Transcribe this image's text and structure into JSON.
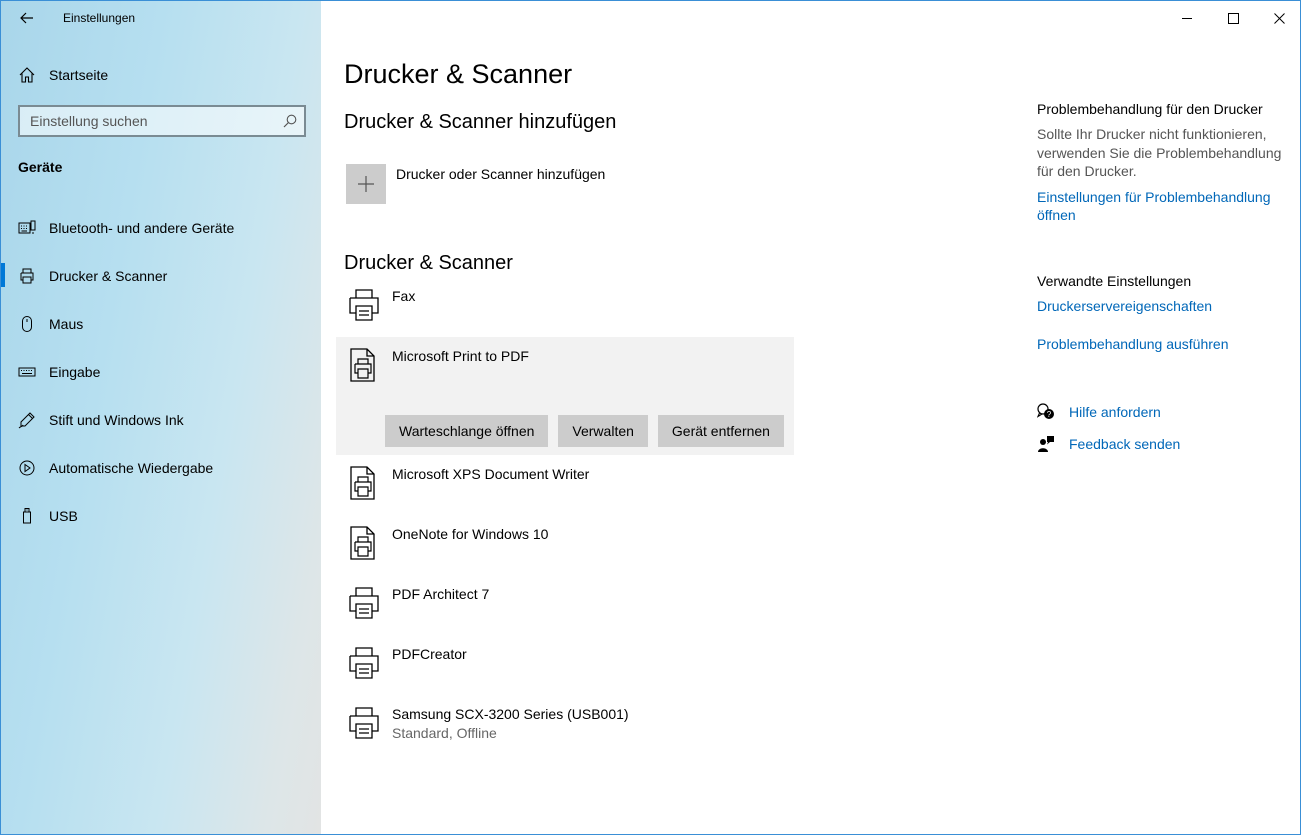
{
  "window": {
    "app_title": "Einstellungen"
  },
  "sidebar": {
    "home_label": "Startseite",
    "search_placeholder": "Einstellung suchen",
    "section_title": "Geräte",
    "items": [
      {
        "label": "Bluetooth- und andere Geräte",
        "icon": "keyboard-bluetooth-icon",
        "active": false
      },
      {
        "label": "Drucker & Scanner",
        "icon": "printer-icon",
        "active": true
      },
      {
        "label": "Maus",
        "icon": "mouse-icon",
        "active": false
      },
      {
        "label": "Eingabe",
        "icon": "keyboard-icon",
        "active": false
      },
      {
        "label": "Stift und Windows Ink",
        "icon": "pen-icon",
        "active": false
      },
      {
        "label": "Automatische Wiedergabe",
        "icon": "autoplay-icon",
        "active": false
      },
      {
        "label": "USB",
        "icon": "usb-icon",
        "active": false
      }
    ]
  },
  "main": {
    "page_title": "Drucker & Scanner",
    "add_section_title": "Drucker & Scanner hinzufügen",
    "add_button_label": "Drucker oder Scanner hinzufügen",
    "list_section_title": "Drucker & Scanner",
    "printers": [
      {
        "name": "Fax",
        "status": "",
        "icon": "printer-icon"
      },
      {
        "name": "Microsoft Print to PDF",
        "status": "",
        "icon": "document-printer-icon",
        "expanded": true
      },
      {
        "name": "Microsoft XPS Document Writer",
        "status": "",
        "icon": "document-printer-icon"
      },
      {
        "name": "OneNote for Windows 10",
        "status": "",
        "icon": "document-printer-icon"
      },
      {
        "name": "PDF Architect 7",
        "status": "",
        "icon": "printer-icon"
      },
      {
        "name": "PDFCreator",
        "status": "",
        "icon": "printer-icon"
      },
      {
        "name": "Samsung SCX-3200 Series (USB001)",
        "status": "Standard, Offline",
        "icon": "printer-icon"
      }
    ],
    "printer_actions": {
      "open_queue": "Warteschlange öffnen",
      "manage": "Verwalten",
      "remove": "Gerät entfernen"
    }
  },
  "right": {
    "troubleshoot_title": "Problembehandlung für den Drucker",
    "troubleshoot_text": "Sollte Ihr Drucker nicht funktionieren, verwenden Sie die Problembehandlung für den Drucker.",
    "troubleshoot_link": "Einstellungen für Problembehandlung öffnen",
    "related_title": "Verwandte Einstellungen",
    "related_links": [
      "Druckerservereigenschaften",
      "Problembehandlung ausführen"
    ],
    "help_label": "Hilfe anfordern",
    "feedback_label": "Feedback senden"
  },
  "colors": {
    "accent": "#0078d7",
    "link": "#0067b8",
    "tile": "#cccccc",
    "selected_row": "#f2f2f2"
  }
}
